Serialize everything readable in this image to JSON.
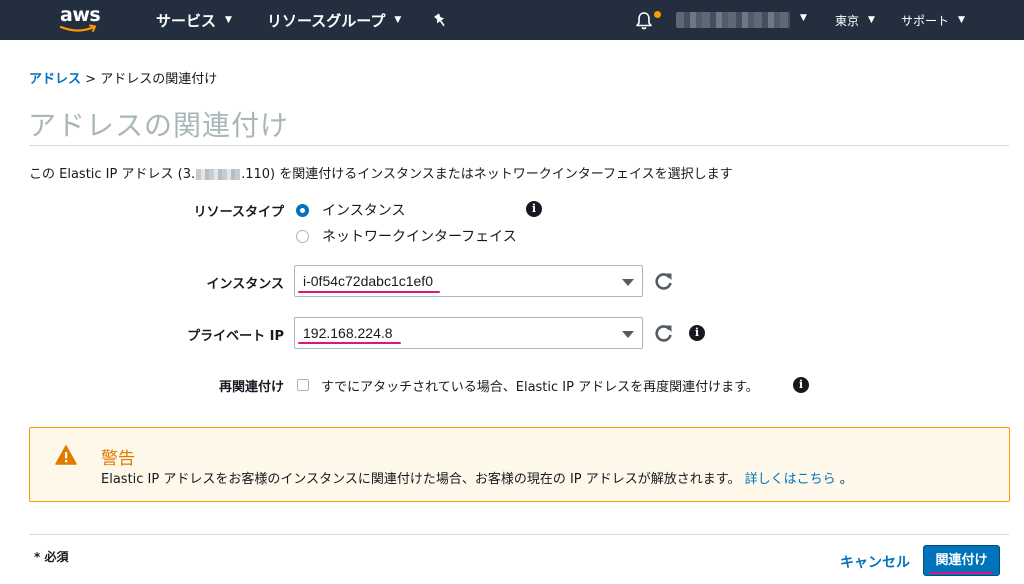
{
  "topnav": {
    "logo_text": "aws",
    "services": "サービス",
    "resource_groups": "リソースグループ",
    "region": "東京",
    "support": "サポート"
  },
  "breadcrumb": {
    "parent": "アドレス",
    "separator": ">",
    "current": "アドレスの関連付け"
  },
  "page": {
    "title": "アドレスの関連付け",
    "description_before": "この Elastic IP アドレス (3.",
    "description_after": ".110) を関連付けるインスタンスまたはネットワークインターフェイスを選択します"
  },
  "form": {
    "resource_type": {
      "label": "リソースタイプ",
      "options": [
        {
          "label": "インスタンス",
          "checked": true
        },
        {
          "label": "ネットワークインターフェイス",
          "checked": false
        }
      ]
    },
    "instance": {
      "label": "インスタンス",
      "value": "i-0f54c72dabc1c1ef0"
    },
    "private_ip": {
      "label": "プライベート IP",
      "value": "192.168.224.8"
    },
    "reassociate": {
      "label": "再関連付け",
      "checkbox_label": "すでにアタッチされている場合、Elastic IP アドレスを再度関連付けます。",
      "checked": false
    }
  },
  "warning": {
    "title": "警告",
    "body": "Elastic IP アドレスをお客様のインスタンスに関連付けた場合、お客様の現在の IP アドレスが解放されます。",
    "link": "詳しくはこちら",
    "suffix": "。"
  },
  "footer": {
    "required": "* 必須",
    "cancel": "キャンセル",
    "associate": "関連付け"
  },
  "colors": {
    "nav_bg": "#232f3e",
    "accent": "#0073bb",
    "warning_border": "#ff9900",
    "warning_bg": "#fef8ea",
    "annotation_underline": "#e0147a"
  }
}
